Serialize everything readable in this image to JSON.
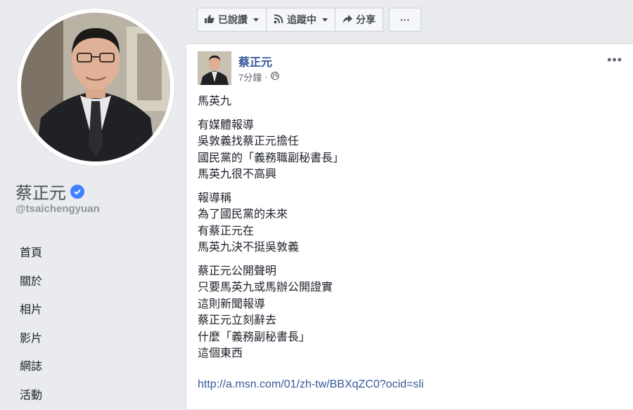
{
  "sidebar": {
    "page_name": "蔡正元",
    "handle": "@tsaichengyuan",
    "nav_items": [
      {
        "label": "首頁"
      },
      {
        "label": "關於"
      },
      {
        "label": "相片"
      },
      {
        "label": "影片"
      },
      {
        "label": "網誌"
      },
      {
        "label": "活動"
      }
    ]
  },
  "action_bar": {
    "liked_label": "已說讚",
    "following_label": "追蹤中",
    "share_label": "分享",
    "more_label": "···"
  },
  "post": {
    "author": "蔡正元",
    "timestamp": "7分鐘",
    "menu_label": "•••",
    "paragraphs": [
      {
        "lines": [
          "馬英九"
        ]
      },
      {
        "lines": [
          "有媒體報導",
          "吳敦義找蔡正元擔任",
          "國民黨的「義務職副秘書長」",
          "馬英九很不高興"
        ]
      },
      {
        "lines": [
          "報導稱",
          "為了國民黨的未來",
          "有蔡正元在",
          "馬英九決不挺吳敦義"
        ]
      },
      {
        "lines": [
          "蔡正元公開聲明",
          "只要馬英九或馬辦公開證實",
          "這則新聞報導",
          "蔡正元立刻辭去",
          "什麼「義務副秘書長」",
          "這個東西"
        ]
      }
    ],
    "link": "http://a.msn.com/01/zh-tw/BBXqZC0?ocid=sli"
  },
  "colors": {
    "background": "#e9ebee",
    "link": "#365899",
    "verified": "#4080ff"
  }
}
